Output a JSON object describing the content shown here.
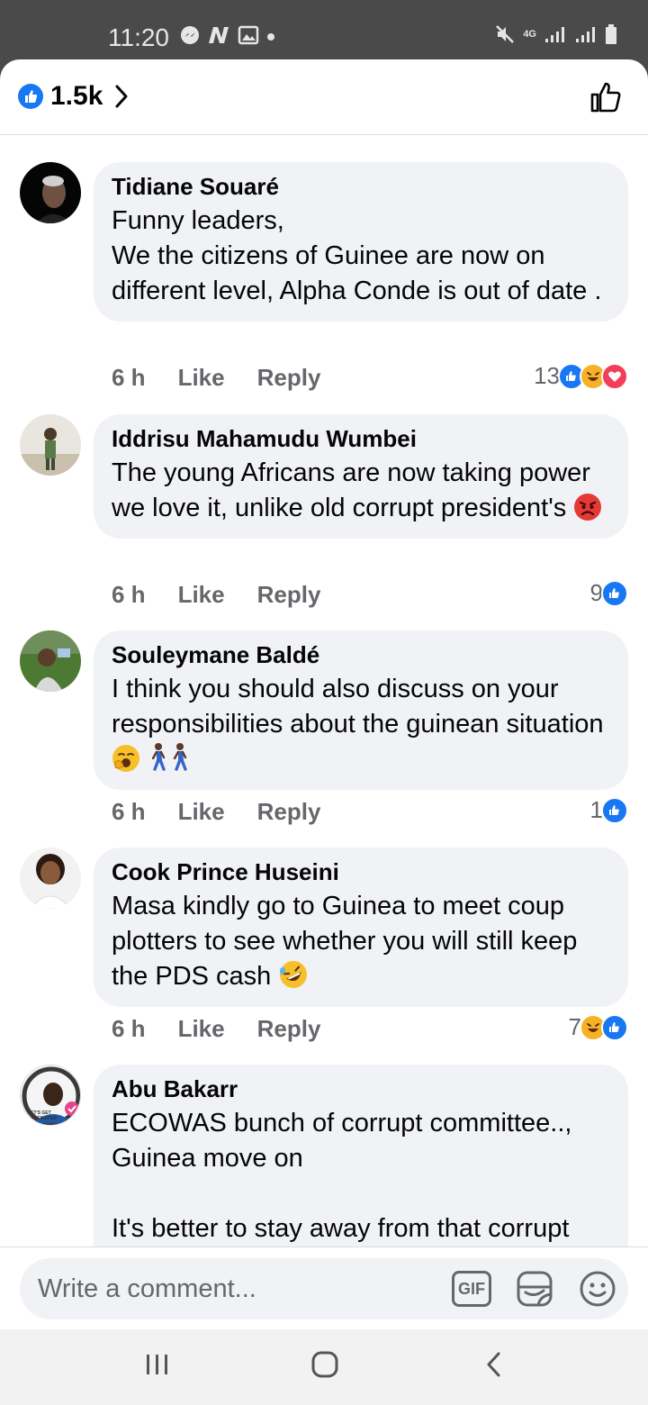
{
  "status_bar": {
    "time": "11:20",
    "network": "4G"
  },
  "header": {
    "likes_count": "1.5k",
    "cut_off_text": "... ... ... ... ..."
  },
  "comments": [
    {
      "author": "Tidiane Souaré",
      "text": "Funny leaders,\nWe the citizens of Guinee are now on different level, Alpha Conde is out of date .",
      "time": "6 h",
      "like_label": "Like",
      "reply_label": "Reply",
      "reaction_count": "13",
      "reactions": [
        "like",
        "haha",
        "love"
      ]
    },
    {
      "author": "Iddrisu Mahamudu Wumbei",
      "text": "The young Africans are now taking power we love it, unlike old corrupt president's",
      "time": "6 h",
      "like_label": "Like",
      "reply_label": "Reply",
      "reaction_count": "9",
      "reactions": [
        "like"
      ]
    },
    {
      "author": "Souleymane Baldé",
      "text": "I think you should also discuss on your responsibilities about the guinean situation",
      "time": "6 h",
      "like_label": "Like",
      "reply_label": "Reply",
      "reaction_count": "1",
      "reactions": [
        "like"
      ]
    },
    {
      "author": "Cook Prince Huseini",
      "text": "Masa kindly go to Guinea to meet coup plotters to see whether you will still keep the PDS cash",
      "time": "6 h",
      "like_label": "Like",
      "reply_label": "Reply",
      "reaction_count": "7",
      "reactions": [
        "haha",
        "like"
      ]
    },
    {
      "author": "Abu Bakarr",
      "text": "ECOWAS bunch of corrupt committee..,\nGuinea move on\n\nIt's better to stay away from that corrupt",
      "avatar_text": "LET'S GET VACCINATED"
    }
  ],
  "composer": {
    "placeholder": "Write a comment...",
    "gif_label": "GIF"
  },
  "colors": {
    "like_blue": "#1877f2",
    "love_red": "#f33e58",
    "haha_yellow": "#f7b125",
    "bubble": "#f0f2f5",
    "meta_gray": "#65676b"
  }
}
